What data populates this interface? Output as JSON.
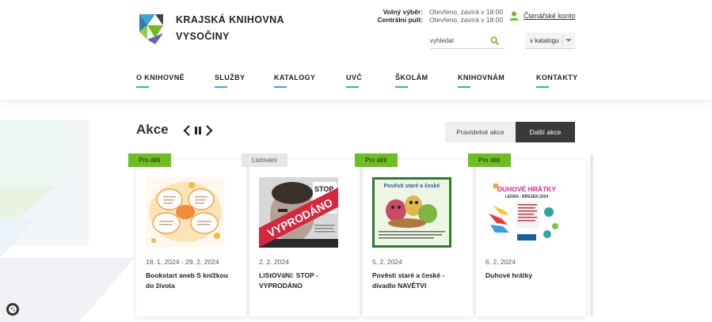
{
  "site": {
    "name_line1": "KRAJSKÁ KNIHOVNA",
    "name_line2": "VYSOČINY"
  },
  "hours": [
    {
      "label": "Volný výběr:",
      "value": "Otevřeno, zavírá v 18:00"
    },
    {
      "label": "Centrální pult:",
      "value": "Otevřeno, zavírá v 18:00"
    }
  ],
  "account": {
    "label": "Čtenářské konto"
  },
  "search": {
    "placeholder": "vyhledat",
    "scope_selected": "v katalogu"
  },
  "nav": [
    "O KNIHOVNĚ",
    "SLUŽBY",
    "KATALOGY",
    "UVČ",
    "ŠKOLÁM",
    "KNIHOVNÁM",
    "KONTAKTY"
  ],
  "events": {
    "heading": "Akce",
    "tab_regular": "Pravidelné akce",
    "tab_other": "Další akce",
    "cards": [
      {
        "category": "Pro děti",
        "date": "18. 1. 2024 - 29. 2. 2024",
        "title": "Bookstart aneb S knížkou do života"
      },
      {
        "category": "Listování",
        "date": "2. 2. 2024",
        "title": "LiStOVáNí: STOP - VYPRODÁNO"
      },
      {
        "category": "Pro děti",
        "date": "5. 2. 2024",
        "title": "Pověsti staré a české - divadlo NAVĚTVI"
      },
      {
        "category": "Pro děti",
        "date": "6. 2. 2024",
        "title": "Duhové hrátky"
      }
    ],
    "thumb_texts": {
      "stop_word": "STOP",
      "sold_out": "VYPRODÁNO",
      "povesti": "Pověsti staré a české",
      "duhove": "DUHOVÉ HRÁTKY",
      "duhove_sub": "LEDEN - BŘEZEN 2024"
    }
  },
  "colors": {
    "accent_green": "#6cbf1e",
    "nav_underline": "#3aa8d0",
    "dark_tab": "#3a3a3a"
  },
  "icons": [
    "logo-mark-icon",
    "user-icon",
    "search-icon",
    "chevron-down-icon",
    "chevron-left-icon",
    "pause-icon",
    "chevron-right-icon",
    "cookie-icon"
  ]
}
